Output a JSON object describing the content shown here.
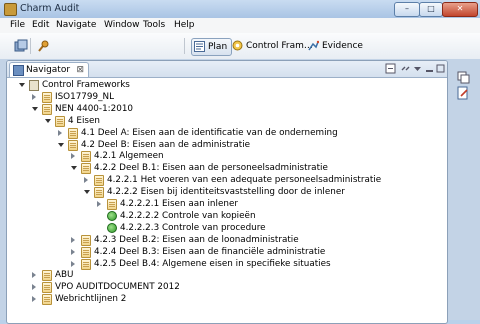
{
  "window": {
    "title": "Charm Audit",
    "controls": {
      "minimize": "–",
      "maximize": "□",
      "close": "✕"
    }
  },
  "menu": [
    "File",
    "Edit",
    "Navigate",
    "Window",
    "Tools",
    "Help"
  ],
  "perspectives": [
    {
      "label": "Plan",
      "active": true,
      "icon": "plan-icon"
    },
    {
      "label": "Control Fram…",
      "active": false,
      "icon": "control-framework-icon"
    },
    {
      "label": "Evidence",
      "active": false,
      "icon": "evidence-icon"
    }
  ],
  "navigator": {
    "tab_label": "Navigator",
    "tab_close": "⊠",
    "tree": [
      {
        "label": "Control Frameworks",
        "type": "root",
        "twisty": "open"
      },
      {
        "label": "ISO17799_NL",
        "type": "folder",
        "twisty": "closed"
      },
      {
        "label": "NEN 4400-1:2010",
        "type": "folder",
        "twisty": "open"
      },
      {
        "label": "4 Eisen",
        "type": "folder",
        "twisty": "open"
      },
      {
        "label": "4.1 Deel A: Eisen aan de identificatie van de onderneming",
        "type": "folder",
        "twisty": "closed"
      },
      {
        "label": "4.2 Deel B: Eisen aan de administratie",
        "type": "folder",
        "twisty": "open"
      },
      {
        "label": "4.2.1 Algemeen",
        "type": "folder",
        "twisty": "closed"
      },
      {
        "label": "4.2.2 Deel B.1: Eisen aan de personeelsadministratie",
        "type": "folder",
        "twisty": "open"
      },
      {
        "label": "4.2.2.1 Het voeren van een adequate personeelsadministratie",
        "type": "folder",
        "twisty": "closed"
      },
      {
        "label": "4.2.2.2 Eisen bij identiteitsvaststelling door de inlener",
        "type": "folder",
        "twisty": "open"
      },
      {
        "label": "4.2.2.2.1 Eisen aan inlener",
        "type": "folder",
        "twisty": "closed"
      },
      {
        "label": "4.2.2.2.2 Controle van kopieën",
        "type": "control",
        "twisty": "none"
      },
      {
        "label": "4.2.2.2.3 Controle van procedure",
        "type": "control",
        "twisty": "none"
      },
      {
        "label": "4.2.3 Deel B.2: Eisen aan de loonadministratie",
        "type": "folder",
        "twisty": "closed"
      },
      {
        "label": "4.2.4 Deel B.3: Eisen aan de financiële administratie",
        "type": "folder",
        "twisty": "closed"
      },
      {
        "label": "4.2.5 Deel B.4: Algemene eisen in specifieke situaties",
        "type": "folder",
        "twisty": "closed"
      },
      {
        "label": "ABU",
        "type": "folder",
        "twisty": "closed"
      },
      {
        "label": "VPO AUDITDOCUMENT 2012",
        "type": "folder",
        "twisty": "closed"
      },
      {
        "label": "Webrichtlijnen 2",
        "type": "folder",
        "twisty": "closed"
      }
    ]
  },
  "colors": {
    "accent": "#3a6ea5",
    "window_frame": "#b9d1ea",
    "control_green": "#2f9a2a",
    "folder": "#f1d48a"
  }
}
